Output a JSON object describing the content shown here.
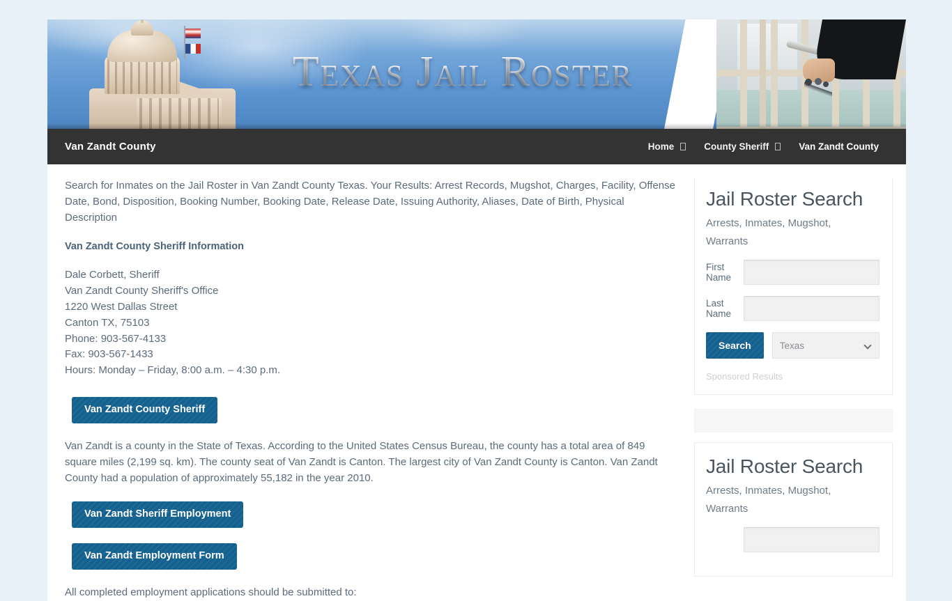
{
  "site": {
    "banner_title": "Texas Jail Roster",
    "brand": "Van Zandt County"
  },
  "nav": {
    "items": [
      {
        "label": "Home",
        "has_caret": true,
        "active": false
      },
      {
        "label": "County Sheriff",
        "has_caret": true,
        "active": false
      },
      {
        "label": "Van Zandt County",
        "has_caret": false,
        "active": true
      }
    ]
  },
  "main": {
    "intro": "Search for Inmates on the Jail Roster in Van Zandt County Texas. Your Results: Arrest Records, Mugshot, Charges, Facility, Offense Date, Bond, Disposition, Booking Number, Booking Date, Release Date, Issuing Authority, Aliases, Date of Birth, Physical Description",
    "section_heading": "Van Zandt County Sheriff Information",
    "address": {
      "line1": "Dale Corbett, Sheriff",
      "line2": "Van Zandt County Sheriff's Office",
      "line3": "1220 West Dallas Street",
      "line4": "Canton TX, 75103",
      "line5": "Phone: 903-567-4133",
      "line6": "Fax: 903-567-1433",
      "line7": "Hours: Monday – Friday, 8:00 a.m. – 4:30 p.m."
    },
    "sheriff_button": "Van Zandt County Sheriff",
    "county_paragraph": "Van Zandt is a county in the State of Texas. According to the United States Census Bureau, the county has a total area of 849 square miles (2,199 sq. km). The county seat of Van Zandt is Canton. The largest city of Van Zandt County is Canton. Van Zandt County had a population of approximately 55,182 in the year 2010.",
    "employment_button": "Van Zandt Sheriff Employment",
    "employment_form_button": "Van Zandt Employment Form",
    "applications_note": "All completed employment applications should be submitted to:"
  },
  "sidebar": {
    "widget_one": {
      "title": "Jail Roster Search",
      "subtitle": "Arrests, Inmates, Mugshot, Warrants",
      "first_name_label": "First Name",
      "first_name_value": "",
      "first_name_placeholder": "",
      "last_name_label": "Last Name",
      "last_name_value": "",
      "last_name_placeholder": "",
      "search_button": "Search",
      "state_selected": "Texas",
      "state_options": [
        "Texas"
      ],
      "sponsored_label": "Sponsored Results"
    },
    "widget_two": {
      "title": "Jail Roster Search",
      "subtitle": "Arrests, Inmates, Mugshot, Warrants"
    }
  },
  "colors": {
    "page_background": "#e7f1f7",
    "navbar": "#333333",
    "button_blue": "#14618f",
    "text": "#5c6b7c"
  }
}
